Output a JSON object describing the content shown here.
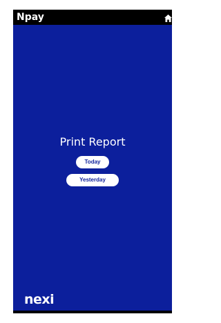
{
  "header": {
    "app_title": "Npay",
    "home_icon": "home-icon"
  },
  "main": {
    "title": "Print Report",
    "buttons": {
      "today_label": "Today",
      "yesterday_label": "Yesterday"
    }
  },
  "footer": {
    "logo_text": "nexi"
  },
  "colors": {
    "background": "#0c1f9c",
    "topbar": "#000000",
    "button_bg": "#ffffff",
    "button_text": "#0c1f9c",
    "text": "#ffffff"
  }
}
